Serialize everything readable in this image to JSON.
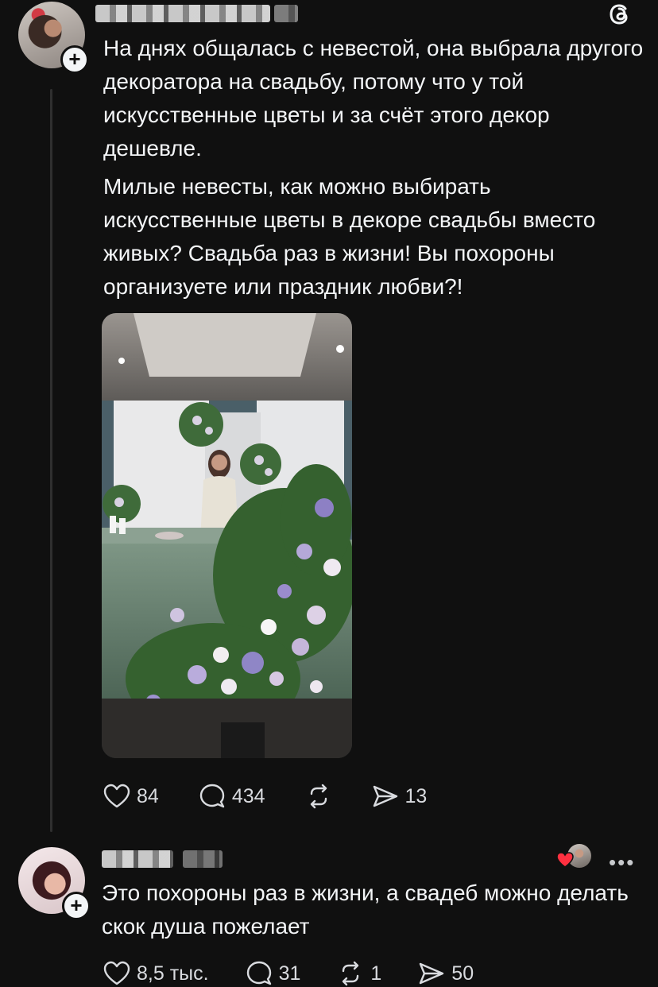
{
  "app": {
    "logo_icon": "threads-logo-icon"
  },
  "post": {
    "paragraphs": [
      "На днях общалась с невестой, она выбрала другого декоратора на свадьбу, потому что у той искусственные цветы и за счёт этого декор дешевле.",
      "Милые невесты, как можно выбирать искусственные цветы в декоре свадьбы вместо живых? Свадьба раз в жизни! Вы похороны организуете или праздник любви?!"
    ],
    "stats": {
      "likes": "84",
      "replies": "434",
      "shares": "13"
    }
  },
  "reply": {
    "text": "Это похороны раз в жизни, а свадеб можно делать скок душа пожелает",
    "stats": {
      "likes": "8,5 тыс.",
      "replies": "31",
      "reposts": "1",
      "shares": "50"
    }
  },
  "colors": {
    "background": "#101010",
    "text": "#f3f5f7",
    "heart_badge": "#ff3040"
  }
}
